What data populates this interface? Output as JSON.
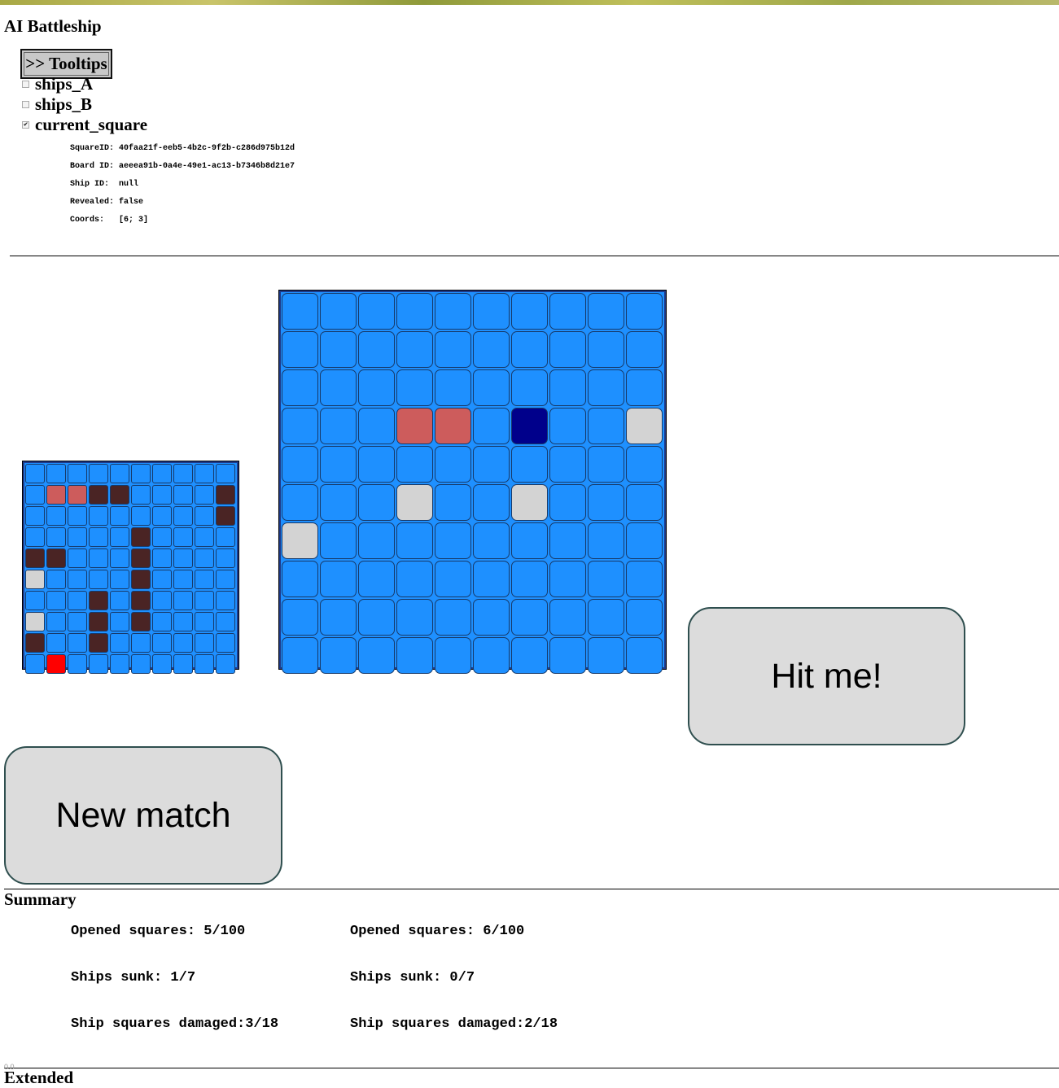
{
  "app": {
    "title": "AI Battleship"
  },
  "tooltips": {
    "toggle_label": ">> Tooltips",
    "options": [
      {
        "label": "ships_A",
        "checked": false
      },
      {
        "label": "ships_B",
        "checked": false
      },
      {
        "label": "current_square",
        "checked": true
      }
    ]
  },
  "current_square": {
    "rows": [
      {
        "key": "SquareID:",
        "value": "40faa21f-eeb5-4b2c-9f2b-c286d975b12d"
      },
      {
        "key": "Board ID:",
        "value": "aeeea91b-0a4e-49e1-ac13-b7346b8d21e7"
      },
      {
        "key": "Ship ID:",
        "value": "null"
      },
      {
        "key": "Revealed:",
        "value": "false"
      },
      {
        "key": "Coords:",
        "value": "[6; 3]"
      }
    ]
  },
  "boards": {
    "legend_colors": {
      "water": "#1e90ff",
      "hit": "#cd5c5c",
      "miss": "#d3d3d3",
      "ship": "#4a2424",
      "current": "#00008b",
      "last_shot": "#ff0000"
    },
    "own_board": [
      ". . . . . . . . . .",
      ". H H S S . . . . S",
      ". . . . . . . . . S",
      ". . . . . S . . . .",
      "S S . . . S . . . .",
      "M . . . . S . . . .",
      ". . . S . S . . . .",
      "M . . S . S . . . .",
      "S . . S . . . . . .",
      ". L . . . . . . . ."
    ],
    "target_board": [
      ". . . . . . . . . .",
      ". . . . . . . . . .",
      ". . . . . . . . . .",
      ". . . H H . C . . M",
      ". . . . . . . . . .",
      ". . . M . . M . . .",
      "M . . . . . . . . .",
      ". . . . . . . . . .",
      ". . . . . . . . . .",
      ". . . . . . . . . ."
    ]
  },
  "actions": {
    "hit_label": "Hit me!",
    "new_match_label": "New match"
  },
  "summary": {
    "title": "Summary",
    "player_a": {
      "opened": "Opened squares: 5/100",
      "sunk": "Ships sunk: 1/7",
      "damaged": "Ship squares damaged:3/18"
    },
    "player_b": {
      "opened": "Opened squares: 6/100",
      "sunk": "Ships sunk: 0/7",
      "damaged": "Ship squares damaged:2/18"
    }
  },
  "extended": {
    "title": "Extended",
    "small_label": "0.0"
  }
}
